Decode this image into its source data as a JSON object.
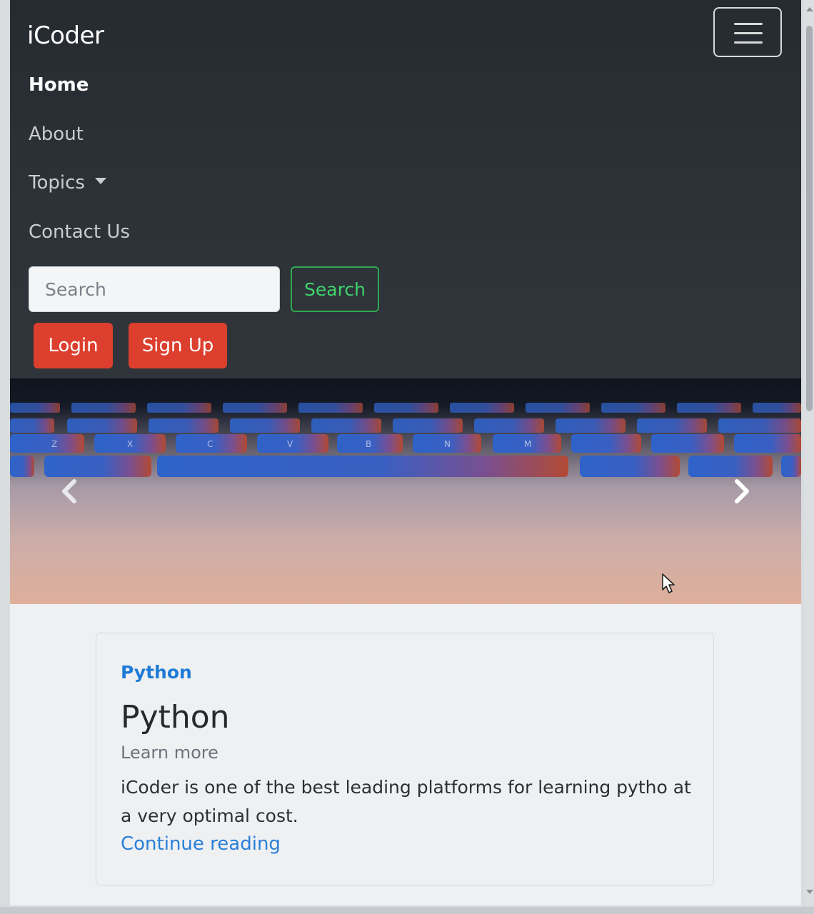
{
  "navbar": {
    "brand": "iCoder",
    "links": [
      {
        "label": "Home",
        "active": true
      },
      {
        "label": "About",
        "active": false
      },
      {
        "label": "Topics",
        "active": false,
        "dropdown": true
      },
      {
        "label": "Contact Us",
        "active": false
      }
    ],
    "search": {
      "placeholder": "Search",
      "value": "",
      "button_label": "Search"
    },
    "login_label": "Login",
    "signup_label": "Sign Up",
    "toggler_icon": "hamburger-icon"
  },
  "carousel": {
    "prev_icon": "chevron-left-icon",
    "next_icon": "chevron-right-icon",
    "key_letters": [
      "Z",
      "X",
      "C",
      "V",
      "B",
      "N",
      "M"
    ]
  },
  "card": {
    "category": "Python",
    "title": "Python",
    "subtitle": "Learn more",
    "text": "iCoder is one of the best leading platforms for learning pytho at a very optimal cost.",
    "link_label": "Continue reading"
  },
  "colors": {
    "navbar_bg": "#2c3238",
    "danger": "#dc3f2e",
    "success": "#3fd36a",
    "link": "#2a7fd8"
  }
}
